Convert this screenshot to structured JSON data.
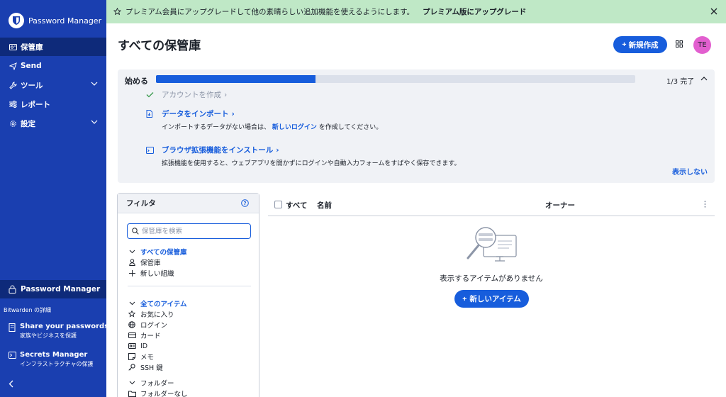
{
  "sidebar": {
    "logo_text": "Password Manager",
    "nav": [
      {
        "label": "保管庫"
      },
      {
        "label": "Send"
      },
      {
        "label": "ツール"
      },
      {
        "label": "レポート"
      },
      {
        "label": "設定"
      }
    ],
    "bottom_product": "Password Manager",
    "about_label": "Bitwarden の詳細",
    "promos": [
      {
        "title": "Share your passwords",
        "subtitle": "家族やビジネスを保護"
      },
      {
        "title": "Secrets Manager",
        "subtitle": "インフラストラクチャの保護"
      }
    ]
  },
  "banner": {
    "text": "プレミアム会員にアップグレードして他の素晴らしい追加機能を使えるようにします。",
    "upgrade_link": "プレミアム版にアップグレード"
  },
  "header": {
    "title": "すべての保管庫",
    "new_button": "新規作成",
    "avatar_initials": "TE"
  },
  "getting_started": {
    "title": "始める",
    "progress": 0.3333,
    "count": "1/3 完了",
    "steps": [
      {
        "label": "アカウントを作成"
      },
      {
        "label": "データをインポート",
        "desc_before": "インポートするデータがない場合は、",
        "desc_link": "新しいログイン",
        "desc_after": "を作成してください。"
      },
      {
        "label": "ブラウザ拡張機能をインストール",
        "desc": "拡張機能を使用すると、ウェブアプリを開かずにログインや自動入力フォームをすばやく保存できます。"
      }
    ],
    "hide_label": "表示しない"
  },
  "filter": {
    "title": "フィルタ",
    "search_placeholder": "保管庫を検索",
    "vaults_heading": "すべての保管庫",
    "vault_items": [
      "保管庫",
      "新しい組織"
    ],
    "items_heading": "全てのアイテム",
    "types": [
      "お気に入り",
      "ログイン",
      "カード",
      "ID",
      "メモ",
      "SSH 鍵"
    ],
    "folders_heading": "フォルダー",
    "folders": [
      "フォルダーなし"
    ]
  },
  "table": {
    "col_all": "すべて",
    "col_name": "名前",
    "col_owner": "オーナー"
  },
  "empty": {
    "text": "表示するアイテムがありません",
    "new_item_button": "新しいアイテム"
  }
}
